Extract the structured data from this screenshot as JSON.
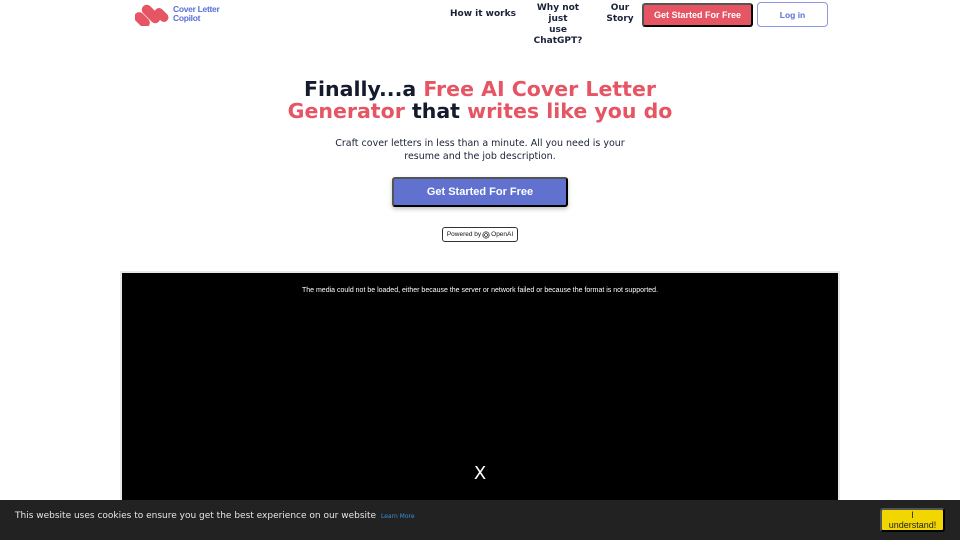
{
  "header": {
    "logo": {
      "line1": "Cover Letter",
      "line2": "Copilot",
      "icon": "logo-mark-icon"
    },
    "nav": {
      "how_it_works": "How it works",
      "why_not_line1": "Why not just",
      "why_not_line2": "use ChatGPT?",
      "story_line1": "Our",
      "story_line2": "Story"
    },
    "cta_label": "Get Started For Free",
    "login_label": "Log in"
  },
  "hero": {
    "title_part1": "Finally...a ",
    "title_accent1": "Free AI Cover Letter",
    "title_accent2": "Generator",
    "title_part2": " that ",
    "title_accent3": "writes like you do",
    "subtitle_line1": "Craft cover letters in less than a minute. All you need is your",
    "subtitle_line2": "resume and the job description.",
    "cta_label": "Get Started For Free",
    "powered_by": "Powered by",
    "powered_brand": "OpenAI"
  },
  "video": {
    "error_message": "The media could not be loaded, either because the server or network failed or because the format is not supported.",
    "close_label": "X"
  },
  "cookie": {
    "message": "This website uses cookies to ensure you get the best experience on our website",
    "learn_more": "Learn More",
    "accept_line1": "I",
    "accept_line2": "understand!"
  },
  "colors": {
    "accent": "#e55564",
    "primary": "#6171d0",
    "logo_text": "#5a6fd6",
    "cookie_bg": "#222222",
    "cookie_button": "#f1d600"
  }
}
